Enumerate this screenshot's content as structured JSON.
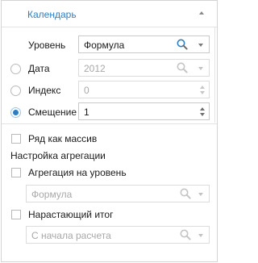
{
  "panel": {
    "title": "Календарь"
  },
  "level": {
    "label": "Уровень",
    "value": "Формула"
  },
  "date": {
    "label": "Дата",
    "value": "2012"
  },
  "index": {
    "label": "Индекс",
    "value": "0"
  },
  "offset": {
    "label": "Смещение",
    "value": "1"
  },
  "series_as_array": {
    "label": "Ряд как массив"
  },
  "aggregation": {
    "section_label": "Настройка агрегации",
    "to_level_label": "Агрегация на уровень",
    "to_level_value": "Формула",
    "cumulative_label": "Нарастающий итог",
    "cumulative_value": "С начала расчета"
  },
  "colors": {
    "accent": "#2e7dc2",
    "border": "#d4d4d4"
  }
}
